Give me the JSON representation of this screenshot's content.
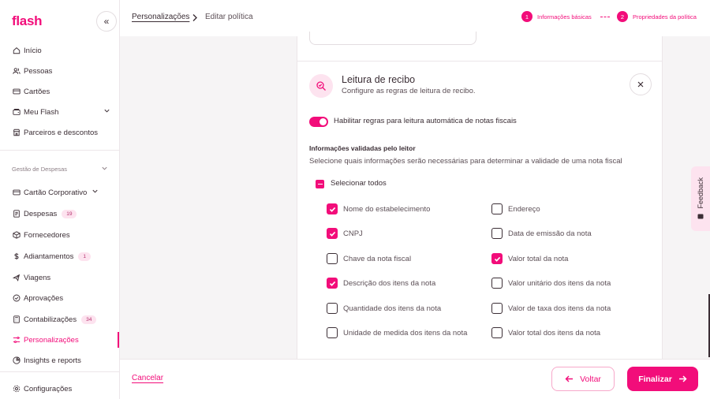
{
  "brand": {
    "logo": "flash",
    "accent": "#f20d7a"
  },
  "sidebar": {
    "collapse_label": "«",
    "items_top": [
      {
        "label": "Início",
        "icon": "home-icon"
      },
      {
        "label": "Pessoas",
        "icon": "people-icon"
      },
      {
        "label": "Cartões",
        "icon": "card-icon"
      },
      {
        "label": "Meu Flash",
        "icon": "wallet-icon"
      },
      {
        "label": "Parceiros e descontos",
        "icon": "store-icon"
      }
    ],
    "section_label": "Gestão de Despesas",
    "items_expenses": [
      {
        "label": "Cartão Corporativo",
        "icon": "card-icon"
      },
      {
        "label": "Despesas",
        "icon": "receipt-icon",
        "badge": "19"
      },
      {
        "label": "Fornecedores",
        "icon": "box-icon"
      },
      {
        "label": "Adiantamentos",
        "icon": "dollar-icon",
        "badge": "1"
      },
      {
        "label": "Viagens",
        "icon": "plane-icon"
      },
      {
        "label": "Aprovações",
        "icon": "check-circle-icon"
      },
      {
        "label": "Contabilizações",
        "icon": "calculator-icon",
        "badge": "34"
      },
      {
        "label": "Personalizações",
        "icon": "sliders-icon",
        "active": true
      },
      {
        "label": "Insights e reports",
        "icon": "chart-icon"
      }
    ],
    "settings_label": "Configurações"
  },
  "header": {
    "breadcrumb_parent": "Personalizações",
    "breadcrumb_current": "Editar política",
    "steps": [
      {
        "num": "1",
        "label": "Informações básicas"
      },
      {
        "num": "2",
        "label": "Propriedades da política"
      }
    ]
  },
  "receipt": {
    "title": "Leitura de recibo",
    "subtitle": "Configure as regras de leitura de recibo.",
    "toggle_label": "Habilitar regras para leitura automática de notas fiscais",
    "toggle_on": true,
    "info_title": "Informações validadas pelo leitor",
    "info_subtitle": "Selecione quais informações serão necessárias para determinar a validade de uma nota fiscal",
    "select_all_label": "Selecionar todos",
    "options_left": [
      {
        "label": "Nome do estabelecimento",
        "checked": true
      },
      {
        "label": "CNPJ",
        "checked": true
      },
      {
        "label": "Chave da nota fiscal",
        "checked": false
      },
      {
        "label": "Descrição dos itens da nota",
        "checked": true
      },
      {
        "label": "Quantidade dos itens da nota",
        "checked": false
      },
      {
        "label": "Unidade de medida dos itens da nota",
        "checked": false
      }
    ],
    "options_right": [
      {
        "label": "Endereço",
        "checked": false
      },
      {
        "label": "Data de emissão da nota",
        "checked": false
      },
      {
        "label": "Valor total da nota",
        "checked": true
      },
      {
        "label": "Valor unitário dos itens da nota",
        "checked": false
      },
      {
        "label": "Valor de taxa dos itens da nota",
        "checked": false
      },
      {
        "label": "Valor total dos itens da nota",
        "checked": false
      }
    ]
  },
  "footer": {
    "cancel_label": "Cancelar",
    "back_label": "Voltar",
    "finish_label": "Finalizar"
  },
  "feedback_label": "Feedback"
}
